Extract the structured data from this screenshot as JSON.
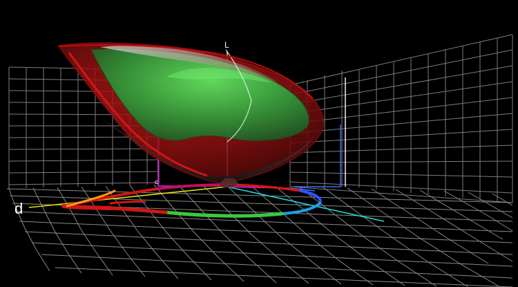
{
  "viewer": {
    "axis_labels": {
      "l": "L",
      "d": "d",
      "c": "c"
    },
    "colors": {
      "background": "#000000",
      "grid": "#8a8a8a",
      "outer_volume": "#b01010",
      "inner_volume": "#2fb84a",
      "axis_yellow": "#e0e010",
      "axis_cyan": "#20d8e0",
      "axis_magenta": "#e020e0",
      "axis_blue": "#3a70ff",
      "axis_white": "#ffffff"
    }
  }
}
